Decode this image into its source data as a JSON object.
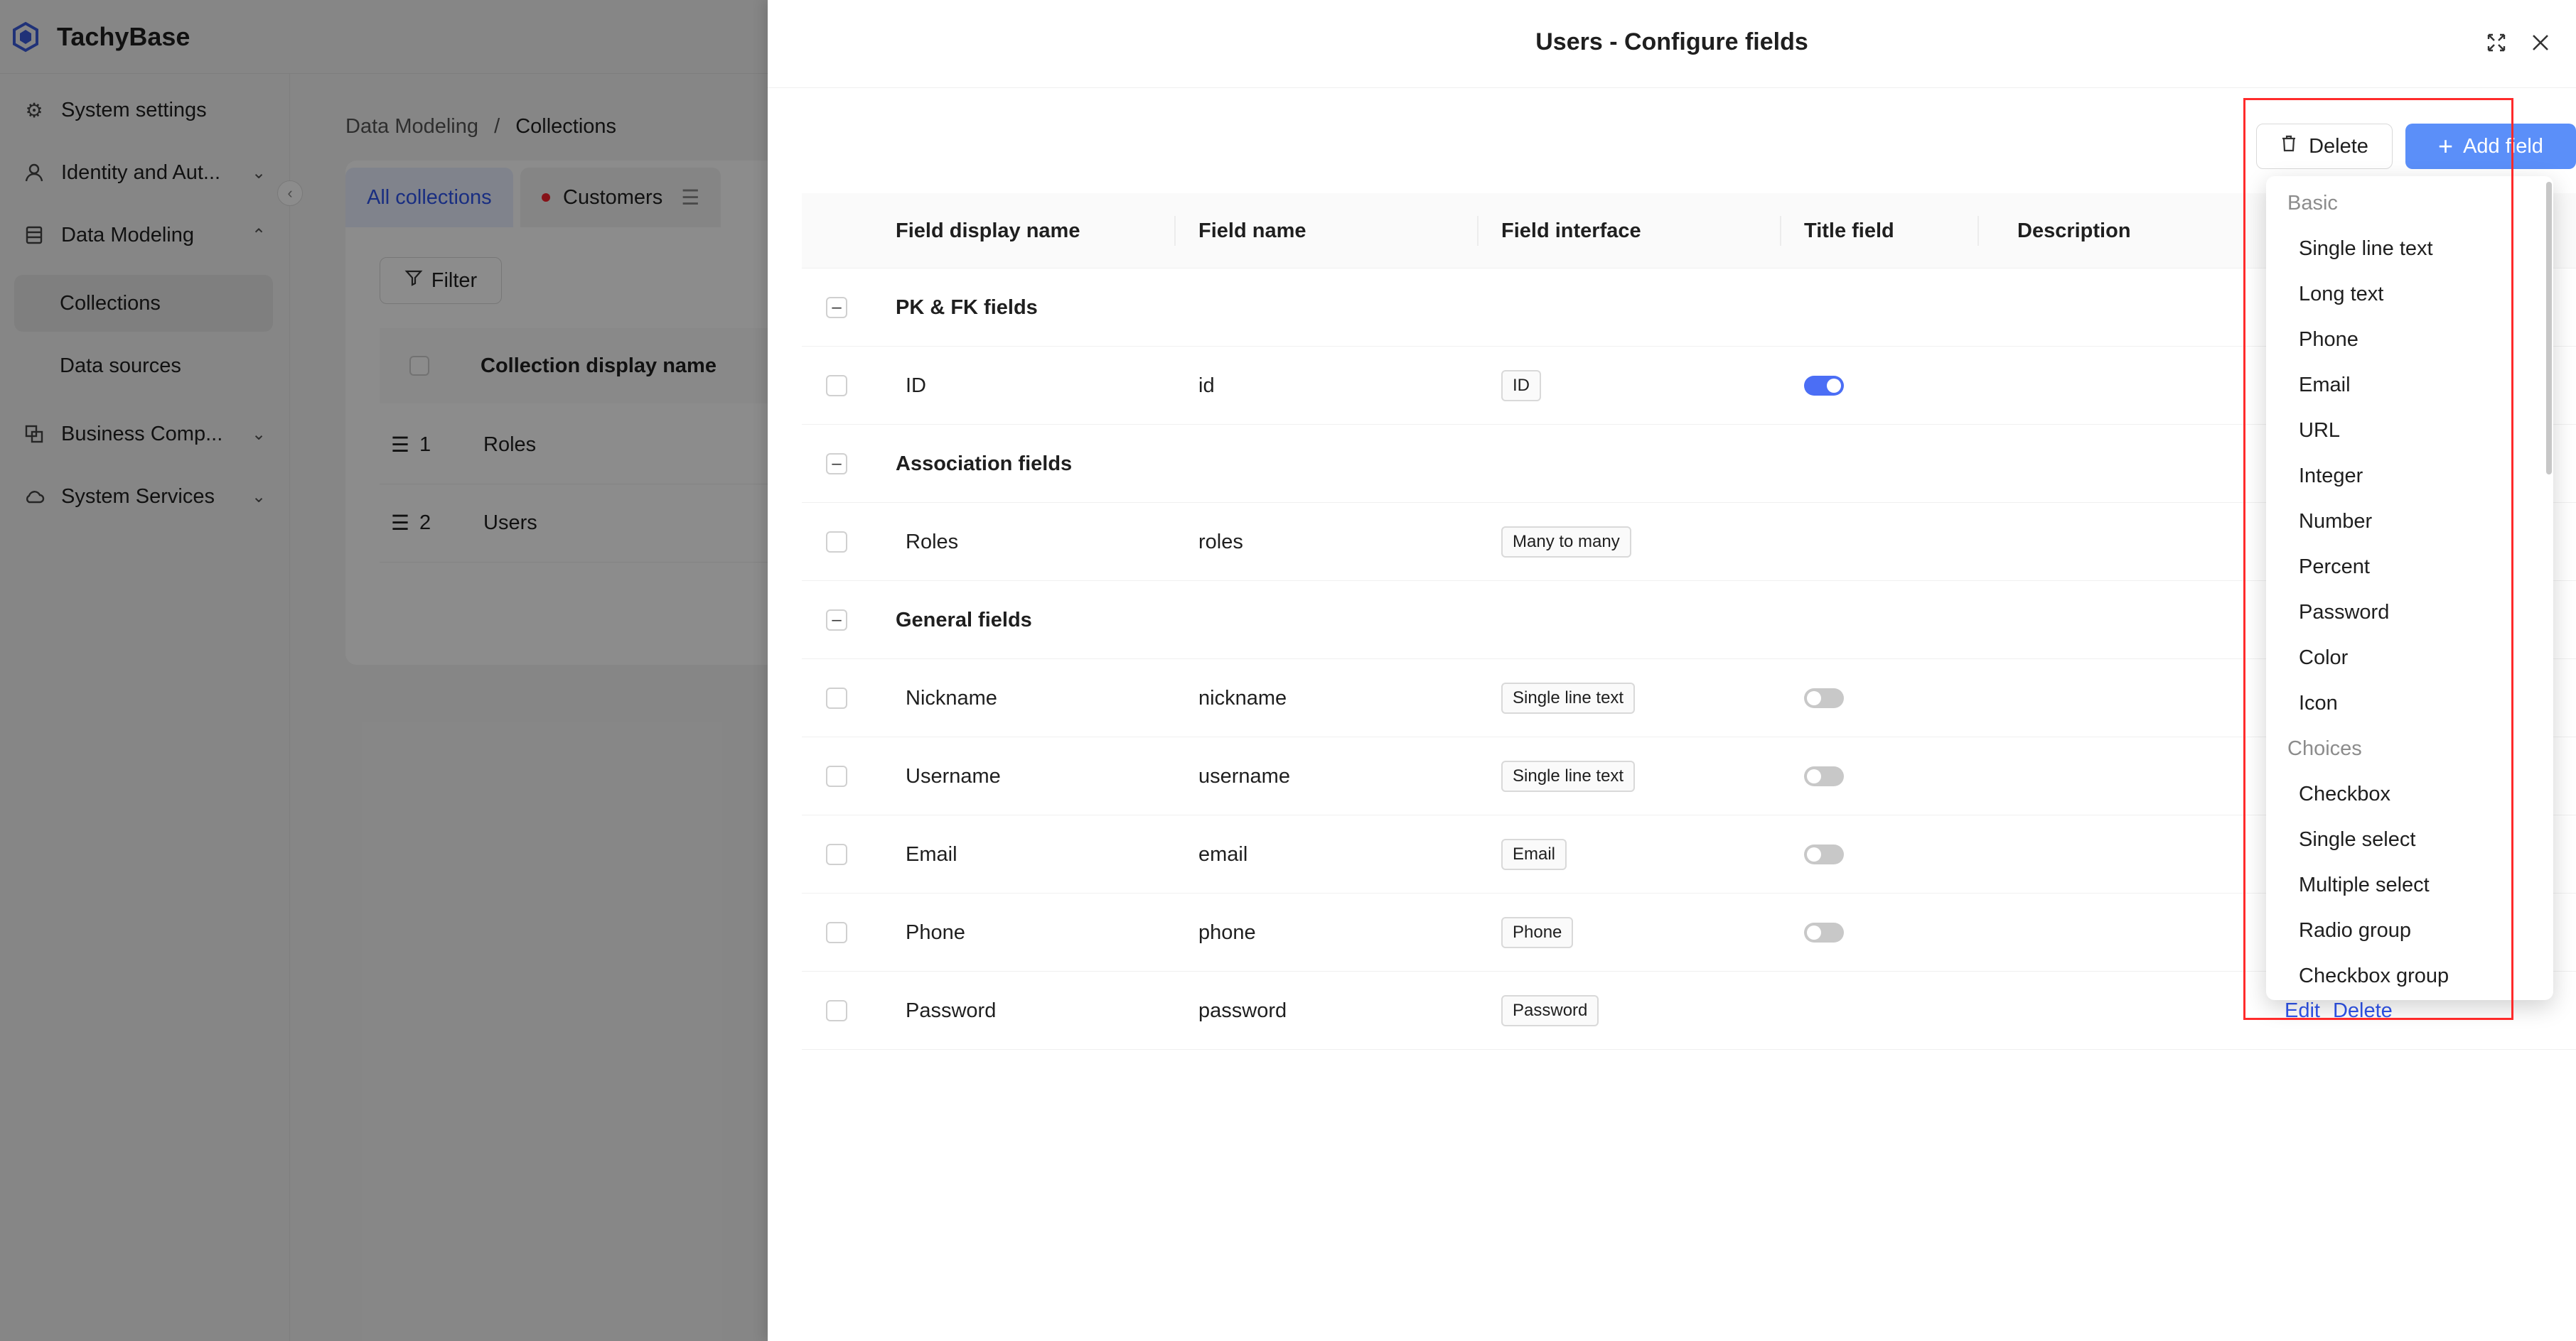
{
  "app": {
    "name": "TachyBase"
  },
  "sidebar": {
    "items": [
      {
        "label": "System settings",
        "icon": "gear-icon",
        "expandable": false
      },
      {
        "label": "Identity and Aut...",
        "icon": "user-icon",
        "expandable": true
      },
      {
        "label": "Data Modeling",
        "icon": "database-icon",
        "expandable": true,
        "expanded": true
      },
      {
        "label": "Business Comp...",
        "icon": "blocks-icon",
        "expandable": true
      },
      {
        "label": "System Services",
        "icon": "cloud-icon",
        "expandable": true
      }
    ],
    "sub_items": [
      {
        "label": "Collections",
        "active": true
      },
      {
        "label": "Data sources",
        "active": false
      }
    ]
  },
  "breadcrumb": {
    "root": "Data Modeling",
    "separator": "/",
    "current": "Collections"
  },
  "collections_page": {
    "tabs": [
      {
        "label": "All collections",
        "active": true
      },
      {
        "label": "Customers",
        "active": false
      }
    ],
    "filter_label": "Filter",
    "table_header": "Collection display name",
    "rows": [
      {
        "index": "1",
        "name": "Roles"
      },
      {
        "index": "2",
        "name": "Users"
      }
    ]
  },
  "drawer": {
    "title": "Users - Configure fields",
    "delete_label": "Delete",
    "add_field_label": "Add field",
    "columns": [
      "Field display name",
      "Field name",
      "Field interface",
      "Title field",
      "Description"
    ],
    "groups": [
      {
        "title": "PK & FK fields",
        "rows": [
          {
            "display": "ID",
            "name": "id",
            "interface": "ID",
            "title_toggle": "on"
          }
        ]
      },
      {
        "title": "Association fields",
        "rows": [
          {
            "display": "Roles",
            "name": "roles",
            "interface": "Many to many",
            "title_toggle": "none"
          }
        ]
      },
      {
        "title": "General fields",
        "rows": [
          {
            "display": "Nickname",
            "name": "nickname",
            "interface": "Single line text",
            "title_toggle": "off"
          },
          {
            "display": "Username",
            "name": "username",
            "interface": "Single line text",
            "title_toggle": "off"
          },
          {
            "display": "Email",
            "name": "email",
            "interface": "Email",
            "title_toggle": "off"
          },
          {
            "display": "Phone",
            "name": "phone",
            "interface": "Phone",
            "title_toggle": "off"
          },
          {
            "display": "Password",
            "name": "password",
            "interface": "Password",
            "title_toggle": "none",
            "actions": [
              "Edit",
              "Delete"
            ]
          }
        ]
      }
    ]
  },
  "add_field_menu": {
    "groups": [
      {
        "label": "Basic",
        "items": [
          "Single line text",
          "Long text",
          "Phone",
          "Email",
          "URL",
          "Integer",
          "Number",
          "Percent",
          "Password",
          "Color",
          "Icon"
        ]
      },
      {
        "label": "Choices",
        "items": [
          "Checkbox",
          "Single select",
          "Multiple select",
          "Radio group",
          "Checkbox group"
        ]
      }
    ]
  },
  "colors": {
    "primary": "#5b8ff9",
    "link": "#2f54eb",
    "highlight": "#ff2b2b",
    "toggle_on": "#4b6ef5"
  }
}
